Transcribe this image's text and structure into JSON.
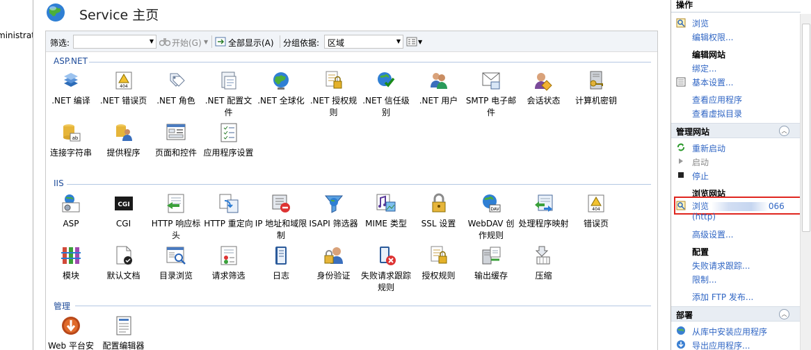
{
  "left_pane": {
    "text": "ministrat"
  },
  "header": {
    "title": "Service 主页"
  },
  "toolbar": {
    "filter_label": "筛选:",
    "start_label": "开始(G)",
    "show_all_label": "全部显示(A)",
    "group_by_label": "分组依据:",
    "group_by_value": "区域"
  },
  "sections": {
    "aspnet": "ASP.NET",
    "iis": "IIS",
    "manage": "管理"
  },
  "aspnet_features": [
    {
      "label": ".NET 编译"
    },
    {
      "label": ".NET 错误页"
    },
    {
      "label": ".NET 角色"
    },
    {
      "label": ".NET 配置文件"
    },
    {
      "label": ".NET 全球化"
    },
    {
      "label": ".NET 授权规则"
    },
    {
      "label": ".NET 信任级别"
    },
    {
      "label": ".NET 用户"
    },
    {
      "label": "SMTP 电子邮件"
    },
    {
      "label": "会话状态"
    },
    {
      "label": "计算机密钥"
    },
    {
      "label": "连接字符串"
    },
    {
      "label": "提供程序"
    },
    {
      "label": "页面和控件"
    },
    {
      "label": "应用程序设置"
    }
  ],
  "iis_features": [
    {
      "label": "ASP"
    },
    {
      "label": "CGI"
    },
    {
      "label": "HTTP 响应标头"
    },
    {
      "label": "HTTP 重定向"
    },
    {
      "label": "IP 地址和域限制"
    },
    {
      "label": "ISAPI 筛选器"
    },
    {
      "label": "MIME 类型"
    },
    {
      "label": "SSL 设置"
    },
    {
      "label": "WebDAV 创作规则"
    },
    {
      "label": "处理程序映射"
    },
    {
      "label": "错误页"
    },
    {
      "label": "模块"
    },
    {
      "label": "默认文档"
    },
    {
      "label": "目录浏览"
    },
    {
      "label": "请求筛选"
    },
    {
      "label": "日志"
    },
    {
      "label": "身份验证"
    },
    {
      "label": "失败请求跟踪规则"
    },
    {
      "label": "授权规则"
    },
    {
      "label": "输出缓存"
    },
    {
      "label": "压缩"
    }
  ],
  "manage_features": [
    {
      "label": "Web 平台安"
    },
    {
      "label": "配置编辑器"
    }
  ],
  "actions": {
    "header": "操作",
    "browse": "浏览",
    "edit_perms": "编辑权限...",
    "edit_site": "编辑网站",
    "bindings": "绑定...",
    "basic_settings": "基本设置...",
    "view_apps": "查看应用程序",
    "view_vdirs": "查看虚拟目录",
    "manage_site_header": "管理网站",
    "restart": "重新启动",
    "start": "启动",
    "stop": "停止",
    "browse_site": "浏览网站",
    "browse_port_prefix": "浏览",
    "browse_port_suffix": "066",
    "browse_http": "(http)",
    "advanced_settings": "高级设置...",
    "config": "配置",
    "failed_req": "失败请求跟踪...",
    "limits": "限制...",
    "add_ftp": "添加 FTP 发布...",
    "deploy_header": "部署",
    "install_from_gallery": "从库中安装应用程序",
    "export_app": "导出应用程序..."
  },
  "colors": {
    "link": "#3066c4",
    "section": "#1f4c9a",
    "highlight": "#e0251e"
  }
}
